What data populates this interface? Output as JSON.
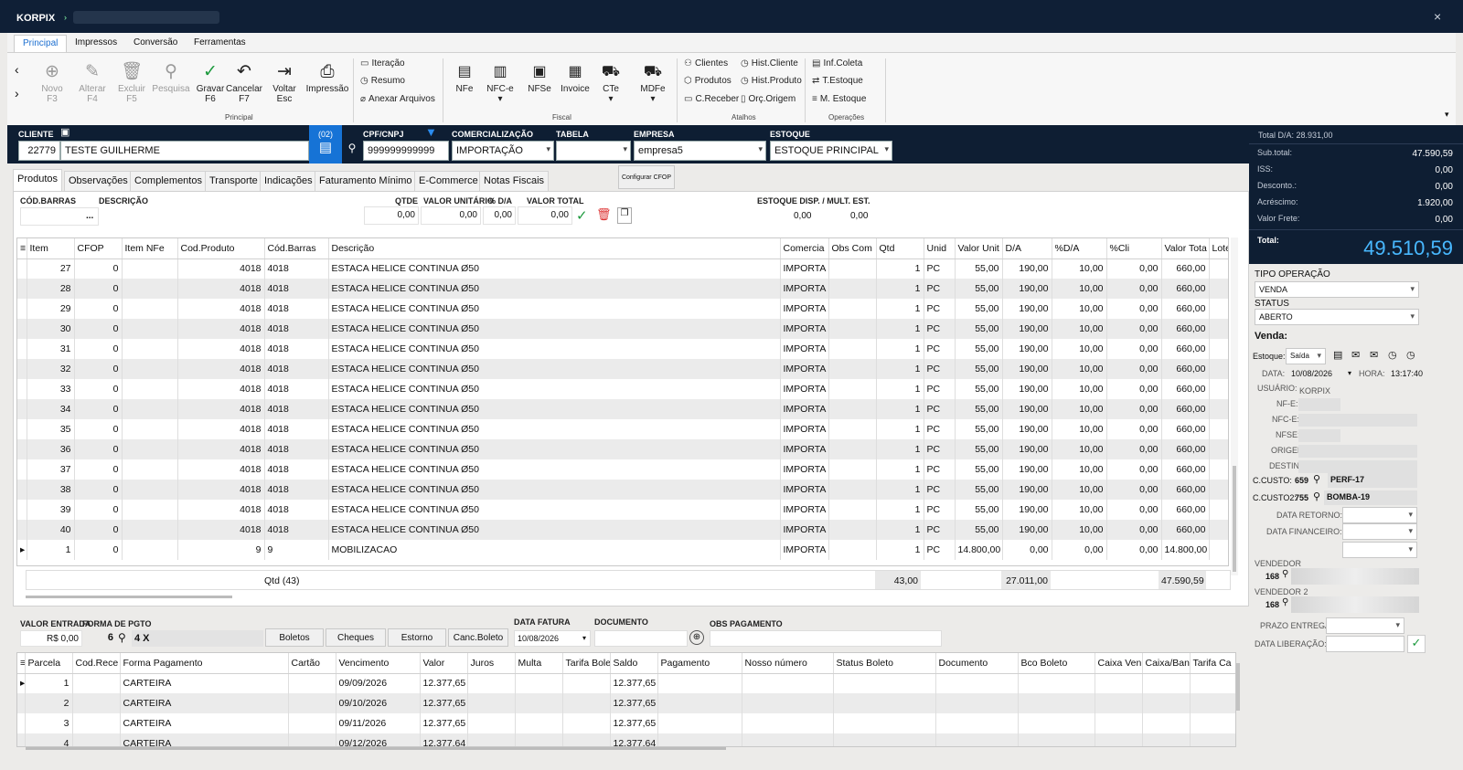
{
  "app": {
    "title": "KORPIX",
    "close": "×"
  },
  "ribbon_tabs": [
    "Principal",
    "Impressos",
    "Conversão",
    "Ferramentas"
  ],
  "ribbon": {
    "main_buttons": [
      {
        "label": "Novo",
        "key": "F3",
        "icon": "⊕"
      },
      {
        "label": "Alterar",
        "key": "F4",
        "icon": "✎"
      },
      {
        "label": "Excluir",
        "key": "F5",
        "icon": "🗑"
      },
      {
        "label": "Pesquisa",
        "key": "",
        "icon": "⚲"
      },
      {
        "label": "Gravar",
        "key": "F6",
        "icon": "✓"
      },
      {
        "label": "Cancelar",
        "key": "F7",
        "icon": "↶"
      },
      {
        "label": "Voltar",
        "key": "Esc",
        "icon": "⇥"
      },
      {
        "label": "Impressão",
        "key": "",
        "icon": "⎙"
      }
    ],
    "small_left": [
      "Iteração",
      "Resumo",
      "Anexar Arquivos"
    ],
    "fiscal": [
      "NFe",
      "NFC-e",
      "NFSe",
      "Invoice",
      "CTe",
      "MDFe"
    ],
    "atalhos_a": [
      "Clientes",
      "Produtos",
      "C.Receber"
    ],
    "atalhos_b": [
      "Hist.Cliente",
      "Hist.Produto",
      "Orç.Origem"
    ],
    "operacoes": [
      "Inf.Coleta",
      "T.Estoque",
      "M. Estoque"
    ],
    "groups": {
      "principal": "Principal",
      "fiscal": "Fiscal",
      "atalhos": "Atalhos",
      "operacoes": "Operações"
    }
  },
  "header": {
    "cliente_label": "CLIENTE",
    "cliente_code": "22779",
    "cliente_name": "TESTE GUILHERME",
    "badge": "(02)",
    "cpf_label": "CPF/CNPJ",
    "cpf": "999999999999",
    "comerc_label": "COMERCIALIZAÇÃO",
    "comerc": "IMPORTAÇÃO",
    "tabela_label": "TABELA",
    "tabela": "",
    "empresa_label": "EMPRESA",
    "empresa": "empresa5",
    "estoque_label": "ESTOQUE",
    "estoque": "ESTOQUE PRINCIPAL"
  },
  "totals": {
    "total_da": "Total D/A: 28.931,00",
    "rows": [
      [
        "Sub.total:",
        "47.590,59"
      ],
      [
        "ISS:",
        "0,00"
      ],
      [
        "Desconto.:",
        "0,00"
      ],
      [
        "Acréscimo:",
        "1.920,00"
      ],
      [
        "Valor Frete:",
        "0,00"
      ]
    ],
    "total_label": "Total:",
    "total": "49.510,59"
  },
  "tabs": [
    "Produtos",
    "Observações",
    "Complementos",
    "Transporte",
    "Indicações",
    "Faturamento Mínimo",
    "E-Commerce",
    "Notas Fiscais"
  ],
  "config_cfop": "Configurar CFOP",
  "entry": {
    "cod_barras": "CÓD.BARRAS",
    "descricao": "DESCRIÇÃO",
    "dots": "...",
    "qtde": "QTDE",
    "valor_unit": "VALOR UNITÁRIO",
    "pct_da": "% D/A",
    "valor_total": "VALOR TOTAL",
    "estoque": "ESTOQUE DISP. / MULT. EST.",
    "qtde_v": "0,00",
    "vu_v": "0,00",
    "da_v": "0,00",
    "vt_v": "0,00",
    "est1": "0,00",
    "est2": "0,00"
  },
  "grid": {
    "columns": [
      "Item",
      "CFOP",
      "Item NFe",
      "Cod.Produto",
      "Cód.Barras",
      "Descrição",
      "Comercia",
      "Obs Com",
      "Qtd",
      "Unid",
      "Valor Unit",
      "D/A",
      "%D/A",
      "%Cli",
      "Valor Tota",
      "Lote"
    ],
    "rows": [
      [
        "27",
        "0",
        "",
        "4018",
        "4018",
        "ESTACA HELICE CONTINUA Ø50",
        "IMPORTA",
        "",
        "1",
        "PC",
        "55,00",
        "190,00",
        "10,00",
        "0,00",
        "660,00",
        ""
      ],
      [
        "28",
        "0",
        "",
        "4018",
        "4018",
        "ESTACA HELICE CONTINUA Ø50",
        "IMPORTA",
        "",
        "1",
        "PC",
        "55,00",
        "190,00",
        "10,00",
        "0,00",
        "660,00",
        ""
      ],
      [
        "29",
        "0",
        "",
        "4018",
        "4018",
        "ESTACA HELICE CONTINUA Ø50",
        "IMPORTA",
        "",
        "1",
        "PC",
        "55,00",
        "190,00",
        "10,00",
        "0,00",
        "660,00",
        ""
      ],
      [
        "30",
        "0",
        "",
        "4018",
        "4018",
        "ESTACA HELICE CONTINUA Ø50",
        "IMPORTA",
        "",
        "1",
        "PC",
        "55,00",
        "190,00",
        "10,00",
        "0,00",
        "660,00",
        ""
      ],
      [
        "31",
        "0",
        "",
        "4018",
        "4018",
        "ESTACA HELICE CONTINUA Ø50",
        "IMPORTA",
        "",
        "1",
        "PC",
        "55,00",
        "190,00",
        "10,00",
        "0,00",
        "660,00",
        ""
      ],
      [
        "32",
        "0",
        "",
        "4018",
        "4018",
        "ESTACA HELICE CONTINUA Ø50",
        "IMPORTA",
        "",
        "1",
        "PC",
        "55,00",
        "190,00",
        "10,00",
        "0,00",
        "660,00",
        ""
      ],
      [
        "33",
        "0",
        "",
        "4018",
        "4018",
        "ESTACA HELICE CONTINUA Ø50",
        "IMPORTA",
        "",
        "1",
        "PC",
        "55,00",
        "190,00",
        "10,00",
        "0,00",
        "660,00",
        ""
      ],
      [
        "34",
        "0",
        "",
        "4018",
        "4018",
        "ESTACA HELICE CONTINUA Ø50",
        "IMPORTA",
        "",
        "1",
        "PC",
        "55,00",
        "190,00",
        "10,00",
        "0,00",
        "660,00",
        ""
      ],
      [
        "35",
        "0",
        "",
        "4018",
        "4018",
        "ESTACA HELICE CONTINUA Ø50",
        "IMPORTA",
        "",
        "1",
        "PC",
        "55,00",
        "190,00",
        "10,00",
        "0,00",
        "660,00",
        ""
      ],
      [
        "36",
        "0",
        "",
        "4018",
        "4018",
        "ESTACA HELICE CONTINUA Ø50",
        "IMPORTA",
        "",
        "1",
        "PC",
        "55,00",
        "190,00",
        "10,00",
        "0,00",
        "660,00",
        ""
      ],
      [
        "37",
        "0",
        "",
        "4018",
        "4018",
        "ESTACA HELICE CONTINUA Ø50",
        "IMPORTA",
        "",
        "1",
        "PC",
        "55,00",
        "190,00",
        "10,00",
        "0,00",
        "660,00",
        ""
      ],
      [
        "38",
        "0",
        "",
        "4018",
        "4018",
        "ESTACA HELICE CONTINUA Ø50",
        "IMPORTA",
        "",
        "1",
        "PC",
        "55,00",
        "190,00",
        "10,00",
        "0,00",
        "660,00",
        ""
      ],
      [
        "39",
        "0",
        "",
        "4018",
        "4018",
        "ESTACA HELICE CONTINUA Ø50",
        "IMPORTA",
        "",
        "1",
        "PC",
        "55,00",
        "190,00",
        "10,00",
        "0,00",
        "660,00",
        ""
      ],
      [
        "40",
        "0",
        "",
        "4018",
        "4018",
        "ESTACA HELICE CONTINUA Ø50",
        "IMPORTA",
        "",
        "1",
        "PC",
        "55,00",
        "190,00",
        "10,00",
        "0,00",
        "660,00",
        ""
      ],
      [
        "1",
        "0",
        "",
        "9",
        "9",
        "MOBILIZACAO",
        "IMPORTA",
        "",
        "1",
        "PC",
        "14.800,00",
        "0,00",
        "0,00",
        "0,00",
        "14.800,00",
        ""
      ]
    ],
    "footer": {
      "qtd": "Qtd (43)",
      "qtd_total": "43,00",
      "da_total": "27.011,00",
      "valor_total": "47.590,59"
    }
  },
  "payment": {
    "valor_entrada_label": "VALOR ENTRADA",
    "valor_entrada": "R$ 0,00",
    "forma_label": "FORMA DE PGTO",
    "forma_code": "6",
    "forma": "4 X",
    "buttons": [
      "Boletos",
      "Cheques",
      "Estorno",
      "Canc.Boleto"
    ],
    "data_fatura_label": "DATA FATURA",
    "data_fatura": "10/08/2026",
    "documento_label": "DOCUMENTO",
    "obs_label": "OBS PAGAMENTO",
    "columns": [
      "Parcela",
      "Cod.Rece",
      "Forma Pagamento",
      "Cartão",
      "Vencimento",
      "Valor",
      "Juros",
      "Multa",
      "Tarifa Bole",
      "Saldo",
      "Pagamento",
      "Nosso número",
      "Status Boleto",
      "Documento",
      "Bco Boleto",
      "Caixa Ven",
      "Caixa/Ban",
      "Tarifa Ca"
    ],
    "rows": [
      [
        "1",
        "",
        "CARTEIRA",
        "",
        "09/09/2026",
        "12.377,65",
        "",
        "",
        "",
        "12.377,65",
        "",
        "",
        "",
        "",
        "",
        "",
        "",
        ""
      ],
      [
        "2",
        "",
        "CARTEIRA",
        "",
        "09/10/2026",
        "12.377,65",
        "",
        "",
        "",
        "12.377,65",
        "",
        "",
        "",
        "",
        "",
        "",
        "",
        ""
      ],
      [
        "3",
        "",
        "CARTEIRA",
        "",
        "09/11/2026",
        "12.377,65",
        "",
        "",
        "",
        "12.377,65",
        "",
        "",
        "",
        "",
        "",
        "",
        "",
        ""
      ],
      [
        "4",
        "",
        "CARTEIRA",
        "",
        "09/12/2026",
        "12.377,64",
        "",
        "",
        "",
        "12.377,64",
        "",
        "",
        "",
        "",
        "",
        "",
        "",
        ""
      ]
    ]
  },
  "side": {
    "tipo_label": "TIPO OPERAÇÃO",
    "tipo": "VENDA",
    "status_label": "STATUS",
    "status": "ABERTO",
    "venda": "Venda:",
    "estoque_label": "Estoque:",
    "estoque": "Saída",
    "data_label": "DATA:",
    "data": "10/08/2026",
    "hora_label": "HORA:",
    "hora": "13:17:40",
    "usuario_label": "USUÁRIO:",
    "usuario": "KORPIX",
    "nfe_label": "NF-E:",
    "nfce_label": "NFC-E:",
    "nfse_label": "NFSE:",
    "origem_label": "ORIGEM:",
    "destino_label": "DESTINO:",
    "ccusto_label": "C.CUSTO:",
    "ccusto_code": "659",
    "ccusto": "PERF-17",
    "ccusto2_label": "C.CUSTO2:",
    "ccusto2_code": "755",
    "ccusto2": "BOMBA-19",
    "data_retorno": "DATA RETORNO:",
    "data_financeiro": "DATA FINANCEIRO:",
    "vendedor_label": "VENDEDOR",
    "vendedor_code": "168",
    "vendedor2_label": "VENDEDOR 2",
    "vendedor2_code": "168",
    "prazo": "PRAZO ENTREGA:",
    "liberacao": "DATA LIBERAÇÃO:"
  }
}
